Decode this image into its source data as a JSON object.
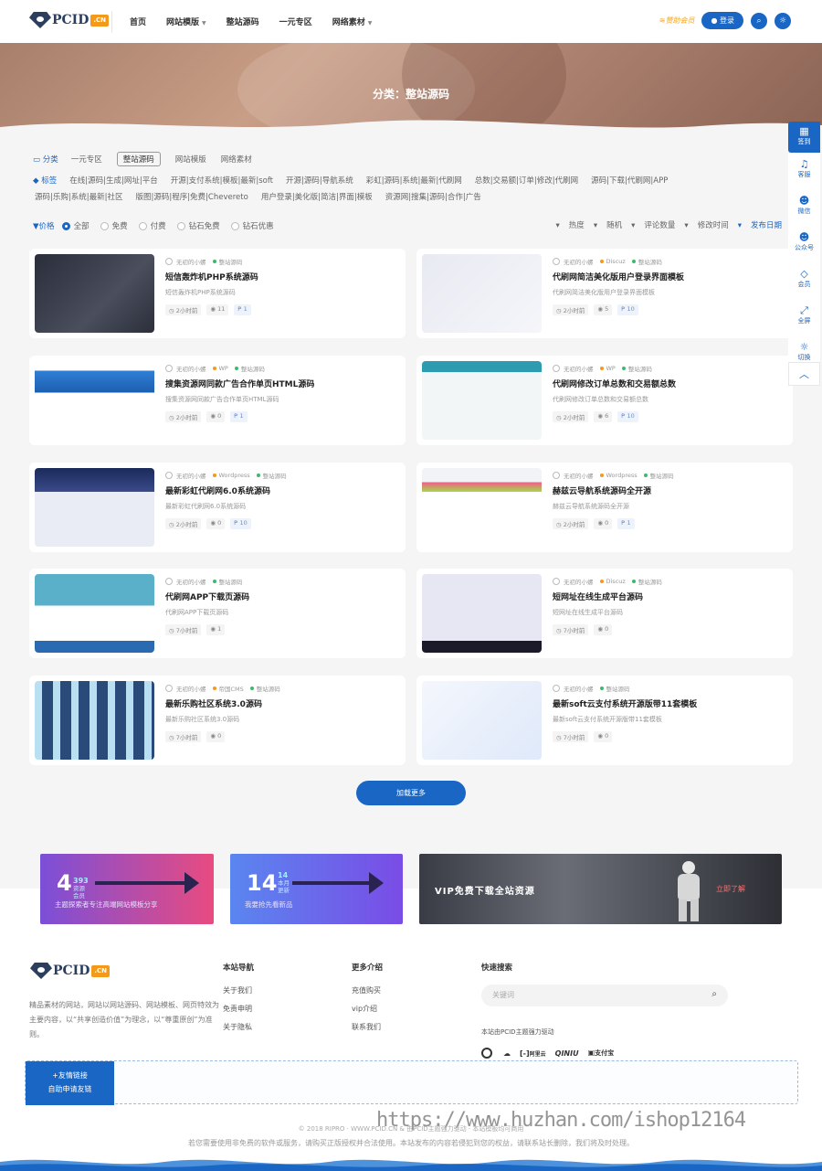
{
  "header": {
    "logo_text": "PCID",
    "logo_cn": ".CN",
    "nav": [
      {
        "label": "首页",
        "caret": false
      },
      {
        "label": "网站模版",
        "caret": true
      },
      {
        "label": "整站源码",
        "caret": false
      },
      {
        "label": "一元专区",
        "caret": false
      },
      {
        "label": "网络素材",
        "caret": true
      }
    ],
    "vip": "赞助会员",
    "login": "登录"
  },
  "banner": {
    "title": "分类：整站源码"
  },
  "filters": {
    "cat_label": "分类",
    "categories": [
      "一元专区",
      "整站源码",
      "网站模版",
      "网络素材"
    ],
    "active_category": "整站源码",
    "tag_label": "标签",
    "tags_row1": [
      "在线|源码|生成|网址|平台",
      "开源|支付系统|模板|最新|soft",
      "开源|源码|导航系统",
      "彩虹|源码|系统|最新|代刷网",
      "总数|交易额|订单|修改|代刷网",
      "源码|下载|代刷网|APP"
    ],
    "tags_row2": [
      "源码|乐购|系统|最新|社区",
      "版图|源码|程序|免费|Chevereto",
      "用户登录|美化版|简洁|界面|模板",
      "资源网|搜集|源码|合作|广告"
    ],
    "price_label": "价格",
    "prices": [
      "全部",
      "免费",
      "付费",
      "钻石免费",
      "钻石优惠"
    ],
    "sorts": [
      "热度",
      "随机",
      "评论数量",
      "修改时间",
      "发布日期"
    ]
  },
  "cards": [
    {
      "author": "无初的小螺",
      "platform": "",
      "category": "整站源码",
      "title": "短信轰炸机PHP系统源码",
      "desc": "短信轰炸机PHP系统源码",
      "time": "2小时前",
      "views": "11",
      "price": "1"
    },
    {
      "author": "无初的小螺",
      "platform": "Discuz",
      "category": "整站源码",
      "title": "代刷网简洁美化版用户登录界面模板",
      "desc": "代刷网简洁美化版用户登录界面模板",
      "time": "2小时前",
      "views": "5",
      "price": "10"
    },
    {
      "author": "无初的小螺",
      "platform": "WP",
      "category": "整站源码",
      "title": "搜集资源网同款广告合作单页HTML源码",
      "desc": "搜集资源网同款广告合作单页HTML源码",
      "time": "2小时前",
      "views": "0",
      "price": "1"
    },
    {
      "author": "无初的小螺",
      "platform": "WP",
      "category": "整站源码",
      "title": "代刷网修改订单总数和交易额总数",
      "desc": "代刷网修改订单总数和交易额总数",
      "time": "2小时前",
      "views": "6",
      "price": "10"
    },
    {
      "author": "无初的小螺",
      "platform": "Wordpress",
      "category": "整站源码",
      "title": "最新彩虹代刷网6.0系统源码",
      "desc": "最新彩虹代刷网6.0系统源码",
      "time": "2小时前",
      "views": "0",
      "price": "10"
    },
    {
      "author": "无初的小螺",
      "platform": "Wordpress",
      "category": "整站源码",
      "title": "赫兹云导航系统源码全开源",
      "desc": "赫兹云导航系统源码全开源",
      "time": "2小时前",
      "views": "0",
      "price": "1"
    },
    {
      "author": "无初的小螺",
      "platform": "",
      "category": "整站源码",
      "title": "代刷网APP下载页源码",
      "desc": "代刷网APP下载页源码",
      "time": "7小时前",
      "views": "1",
      "price": ""
    },
    {
      "author": "无初的小螺",
      "platform": "Discuz",
      "category": "整站源码",
      "title": "短网址在线生成平台源码",
      "desc": "短网址在线生成平台源码",
      "time": "7小时前",
      "views": "0",
      "price": ""
    },
    {
      "author": "无初的小螺",
      "platform": "帝国CMS",
      "category": "整站源码",
      "title": "最新乐购社区系统3.0源码",
      "desc": "最新乐购社区系统3.0源码",
      "time": "7小时前",
      "views": "0",
      "price": ""
    },
    {
      "author": "无初的小螺",
      "platform": "",
      "category": "整站源码",
      "title": "最新soft云支付系统开源版带11套模板",
      "desc": "最新soft云支付系统开源版带11套模板",
      "time": "7小时前",
      "views": "0",
      "price": ""
    }
  ],
  "load_more": "加载更多",
  "promo": {
    "p1_big": "4",
    "p1_small1": "393",
    "p1_small2": "资源",
    "p1_small3": "会员",
    "p1_caption": "主题探索者专注高端网站模板分享",
    "p2_big": "14",
    "p2_small1": "14",
    "p2_small2": "本月",
    "p2_small3": "更新",
    "p2_caption": "我要抢先看新品",
    "p3_text": "VIP免费下载全站资源",
    "p3_link": "立即了解"
  },
  "footer": {
    "desc": "精品素材的网站，网站以网站源码、网站模板、网页特效为主要内容，以“共享创造价值”为理念，以“尊重原创”为准则。",
    "nav_title": "本站导航",
    "nav_links": [
      "关于我们",
      "免责申明",
      "关于隐私"
    ],
    "more_title": "更多介绍",
    "more_links": [
      "充值购买",
      "vip介绍",
      "联系我们"
    ],
    "search_title": "快速搜索",
    "search_placeholder": "关键词",
    "power": "本站由PCID主题强力驱动",
    "partners": [
      "",
      "",
      "阿里云",
      "QINIU",
      "支付宝"
    ],
    "friend_tab1": "+友情链接",
    "friend_tab2": "自助申请友链",
    "copyright": "© 2018 RIPRO · WWW.PCID.CN & 由PCID主题强力驱动 · 本站模板均可商用",
    "disclaimer": "若您需要使用非免费的软件或服务，请购买正版授权并合法使用。本站发布的内容若侵犯到您的权益，请联系站长删除，我们将及时处理。",
    "watermark": "https://www.huzhan.com/ishop12164"
  },
  "side": {
    "items": [
      "签到",
      "客服",
      "微信",
      "公众号",
      "会员",
      "全屏",
      "切换"
    ]
  },
  "colors": {
    "accent": "#1a66c4",
    "promo1": "#e94a82",
    "promo2": "#6a4ae0"
  }
}
